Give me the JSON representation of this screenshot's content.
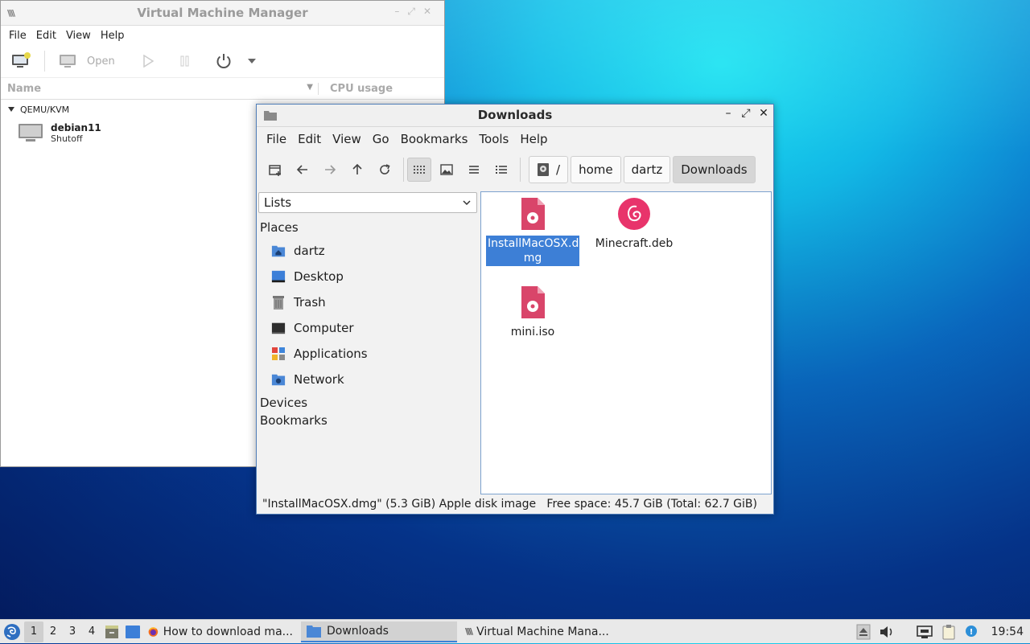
{
  "vmm": {
    "title": "Virtual Machine Manager",
    "menu": [
      "File",
      "Edit",
      "View",
      "Help"
    ],
    "toolbar": {
      "open_label": "Open"
    },
    "columns": {
      "name": "Name",
      "cpu": "CPU usage"
    },
    "group": "QEMU/KVM",
    "vm": {
      "name": "debian11",
      "state": "Shutoff"
    }
  },
  "fm": {
    "title": "Downloads",
    "menu": [
      "File",
      "Edit",
      "View",
      "Go",
      "Bookmarks",
      "Tools",
      "Help"
    ],
    "breadcrumbs": [
      "/",
      "home",
      "dartz",
      "Downloads"
    ],
    "sidebar_mode": "Lists",
    "places_heading": "Places",
    "places": [
      {
        "label": "dartz",
        "icon": "home-folder-icon"
      },
      {
        "label": "Desktop",
        "icon": "desktop-icon"
      },
      {
        "label": "Trash",
        "icon": "trash-icon"
      },
      {
        "label": "Computer",
        "icon": "computer-icon"
      },
      {
        "label": "Applications",
        "icon": "applications-icon"
      },
      {
        "label": "Network",
        "icon": "network-folder-icon"
      }
    ],
    "devices_heading": "Devices",
    "bookmarks_heading": "Bookmarks",
    "files": [
      {
        "name": "InstallMacOSX.d\nmg",
        "icon": "disk-image-icon",
        "selected": true
      },
      {
        "name": "Minecraft.deb",
        "icon": "debian-package-icon",
        "selected": false
      },
      {
        "name": "mini.iso",
        "icon": "disk-image-icon",
        "selected": false
      }
    ],
    "status_left": "\"InstallMacOSX.dmg\" (5.3 GiB) Apple disk image",
    "status_right": "Free space: 45.7 GiB (Total: 62.7 GiB)"
  },
  "taskbar": {
    "workspaces": [
      "1",
      "2",
      "3",
      "4"
    ],
    "active_workspace": "1",
    "tasks": [
      {
        "label": "How to download ma...",
        "icon": "firefox-icon"
      },
      {
        "label": "Downloads",
        "icon": "folder-icon"
      },
      {
        "label": "Virtual Machine Mana...",
        "icon": "vmm-icon"
      }
    ],
    "clock": "19:54"
  },
  "colors": {
    "accent": "#3d7fd6",
    "disk_image": "#d9456a",
    "debian": "#e8346b"
  }
}
